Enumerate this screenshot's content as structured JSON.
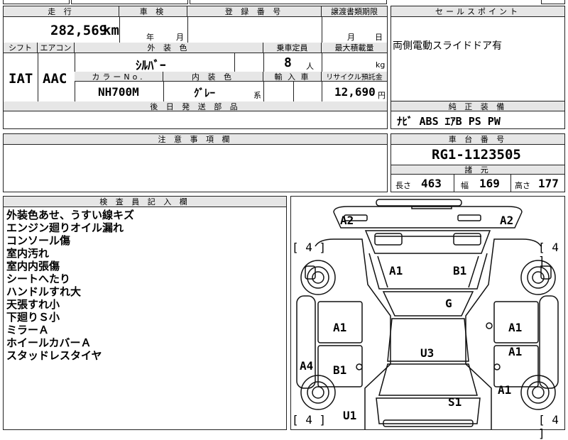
{
  "top": {
    "mileage_header": "走 行",
    "mileage_value": "282,569",
    "mileage_unit": "km",
    "inspection_header": "車 検",
    "inspection_year": "年",
    "inspection_month": "月",
    "registration_header": "登 録 番 号",
    "transfer_header": "譲渡書類期限",
    "transfer_month": "月",
    "transfer_day": "日",
    "sales_point_header": "セールスポイント",
    "sales_point_text": "両側電動スライドドア有"
  },
  "spec": {
    "shift_label": "シフト",
    "shift_value": "IAT",
    "aircon_label": "エアコン",
    "aircon_value": "AAC",
    "exterior_color_label": "外 装 色",
    "exterior_color_value": "ｼﾙﾊﾞｰ",
    "capacity_label": "乗車定員",
    "capacity_value": "8",
    "capacity_unit": "人",
    "max_load_label": "最大積載量",
    "max_load_unit": "kg",
    "color_no_label": "カラーNo.",
    "color_no_value": "NH700M",
    "interior_color_label": "内 装 色",
    "interior_color_value": "ｸﾞﾚｰ",
    "interior_color_suffix": "系",
    "import_label": "輸 入 車",
    "recycle_label": "リサイクル預託金",
    "recycle_value": "12,690",
    "recycle_unit": "円",
    "parts_header": "後 日 発 送 部 品"
  },
  "equipment": {
    "header": "純 正 装 備",
    "items": "ﾅﾋﾞ ABS ｴｱB PS PW"
  },
  "caution": {
    "header": "注 意 事 項 欄"
  },
  "chassis": {
    "header": "車 台 番 号",
    "value": "RG1-1123505"
  },
  "dimensions": {
    "header": "諸 元",
    "length_label": "長さ",
    "length_value": "463",
    "width_label": "幅",
    "width_value": "169",
    "height_label": "高さ",
    "height_value": "177"
  },
  "inspector": {
    "header": "検 査 員 記 入 欄",
    "notes": [
      "外装色あせ、うすい線キズ",
      "エンジン廻りオイル漏れ",
      "コンソール傷",
      "室内汚れ",
      "室内内張傷",
      "シートへたり",
      "ハンドルすれ大",
      "天張すれ小",
      "下廻りＳ小",
      "ミラーＡ",
      "ホイールカバーＡ",
      "スタッドレスタイヤ"
    ]
  },
  "diagram": {
    "codes": {
      "front_left": "A2",
      "front_right": "A2",
      "hood_left": "A1",
      "hood_right": "B1",
      "windshield": "G",
      "left_fender": "A1",
      "right_fender": "A1",
      "left_door": "B1",
      "right_door": "A1",
      "roof": "U3",
      "left_side": "A4",
      "right_rear": "A1",
      "rear_center": "S1",
      "rear_left": "U1"
    },
    "tire_brackets": [
      "[ 4 ]",
      "[ 4 ]",
      "[ 4 ]",
      "[ 4 ]"
    ]
  }
}
